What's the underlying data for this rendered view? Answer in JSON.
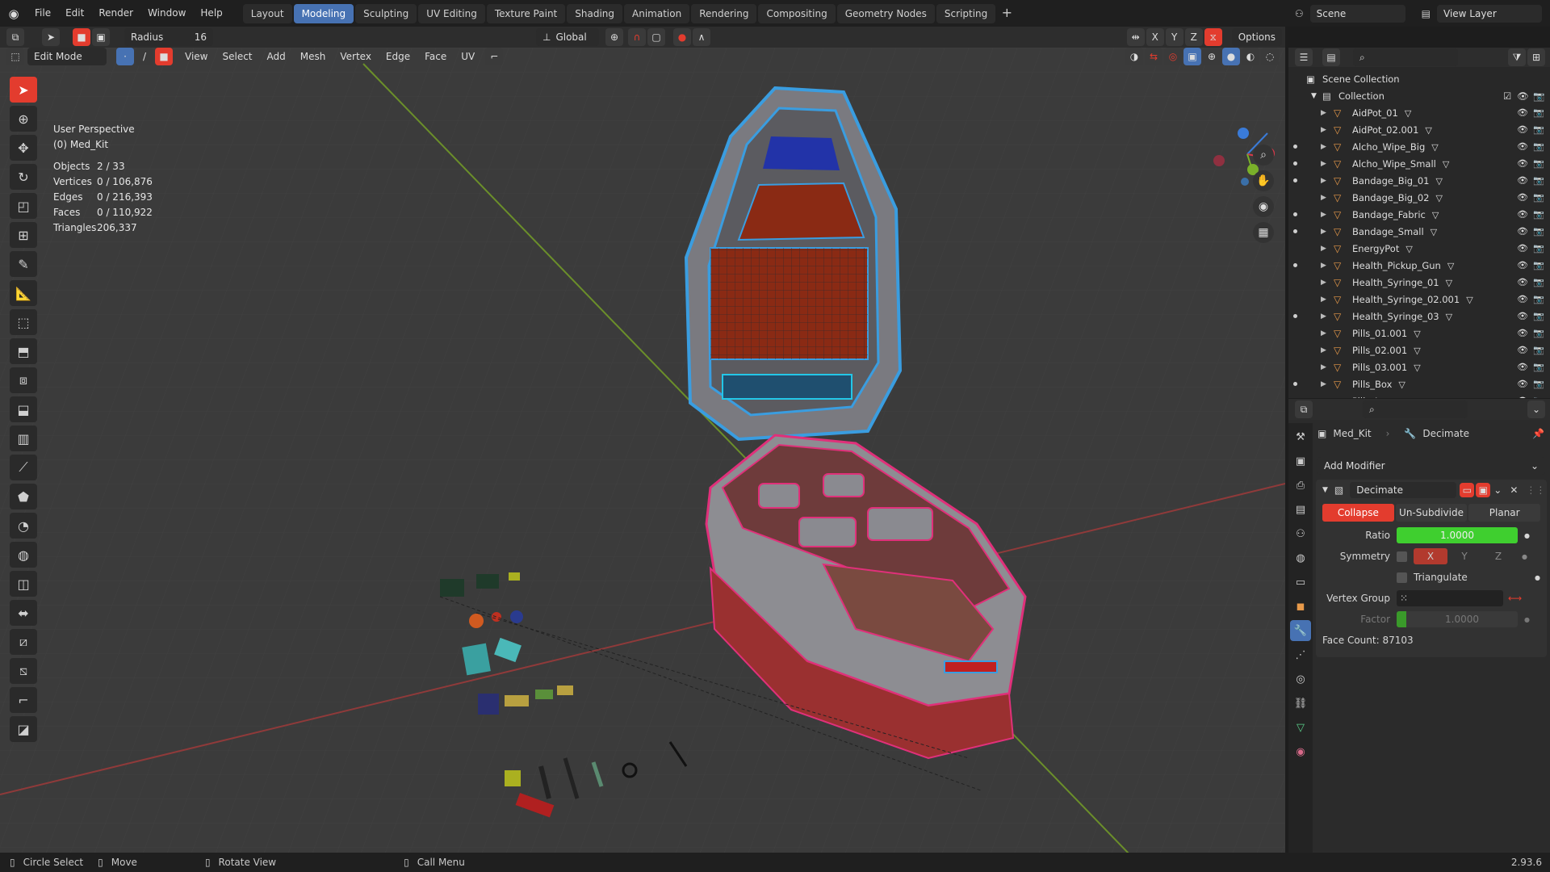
{
  "topbar": {
    "menus": [
      "File",
      "Edit",
      "Render",
      "Window",
      "Help"
    ],
    "workspaces": [
      "Layout",
      "Modeling",
      "Sculpting",
      "UV Editing",
      "Texture Paint",
      "Shading",
      "Animation",
      "Rendering",
      "Compositing",
      "Geometry Nodes",
      "Scripting"
    ],
    "active_workspace": "Modeling",
    "scene_label": "Scene",
    "view_layer_label": "View Layer"
  },
  "tool_header": {
    "radius_label": "Radius",
    "radius_value": "16",
    "transform_orientation": "Global",
    "options_label": "Options",
    "axes": [
      "X",
      "Y",
      "Z"
    ]
  },
  "viewport_header": {
    "mode": "Edit Mode",
    "menus": [
      "View",
      "Select",
      "Add",
      "Mesh",
      "Vertex",
      "Edge",
      "Face",
      "UV"
    ]
  },
  "viewport": {
    "perspective": "User Perspective",
    "object": "(0) Med_Kit",
    "stats": [
      {
        "label": "Objects",
        "value": "2 / 33"
      },
      {
        "label": "Vertices",
        "value": "0 / 106,876"
      },
      {
        "label": "Edges",
        "value": "0 / 216,393"
      },
      {
        "label": "Faces",
        "value": "0 / 110,922"
      },
      {
        "label": "Triangles",
        "value": "206,337"
      }
    ]
  },
  "outliner": {
    "root": "Scene Collection",
    "collection": "Collection",
    "items": [
      {
        "name": "AidPot_01",
        "dot": false
      },
      {
        "name": "AidPot_02.001",
        "dot": false
      },
      {
        "name": "Alcho_Wipe_Big",
        "dot": true
      },
      {
        "name": "Alcho_Wipe_Small",
        "dot": true
      },
      {
        "name": "Bandage_Big_01",
        "dot": true
      },
      {
        "name": "Bandage_Big_02",
        "dot": false
      },
      {
        "name": "Bandage_Fabric",
        "dot": true
      },
      {
        "name": "Bandage_Small",
        "dot": true
      },
      {
        "name": "EnergyPot",
        "dot": false
      },
      {
        "name": "Health_Pickup_Gun",
        "dot": true
      },
      {
        "name": "Health_Syringe_01",
        "dot": false
      },
      {
        "name": "Health_Syringe_02.001",
        "dot": false
      },
      {
        "name": "Health_Syringe_03",
        "dot": true
      },
      {
        "name": "Pills_01.001",
        "dot": false
      },
      {
        "name": "Pills_02.001",
        "dot": false
      },
      {
        "name": "Pills_03.001",
        "dot": false
      },
      {
        "name": "Pills_Box",
        "dot": true
      },
      {
        "name": "Pills_Jar",
        "dot": true
      }
    ]
  },
  "properties": {
    "object_name": "Med_Kit",
    "modifier_tab_name": "Decimate",
    "add_modifier": "Add Modifier",
    "modifier": {
      "name": "Decimate",
      "modes": [
        "Collapse",
        "Un-Subdivide",
        "Planar"
      ],
      "active_mode": "Collapse",
      "ratio_label": "Ratio",
      "ratio_value": "1.0000",
      "symmetry_label": "Symmetry",
      "symmetry_axes": [
        "X",
        "Y",
        "Z"
      ],
      "triangulate_label": "Triangulate",
      "vertex_group_label": "Vertex Group",
      "factor_label": "Factor",
      "factor_value": "1.0000",
      "face_count": "Face Count: 87103"
    }
  },
  "statusbar": {
    "items": [
      "Circle Select",
      "Move",
      "Rotate View",
      "Call Menu"
    ],
    "version": "2.93.6"
  },
  "colors": {
    "accent": "#4772b3",
    "active_red": "#e33c2e",
    "ratio_green": "#3fcf2f"
  }
}
